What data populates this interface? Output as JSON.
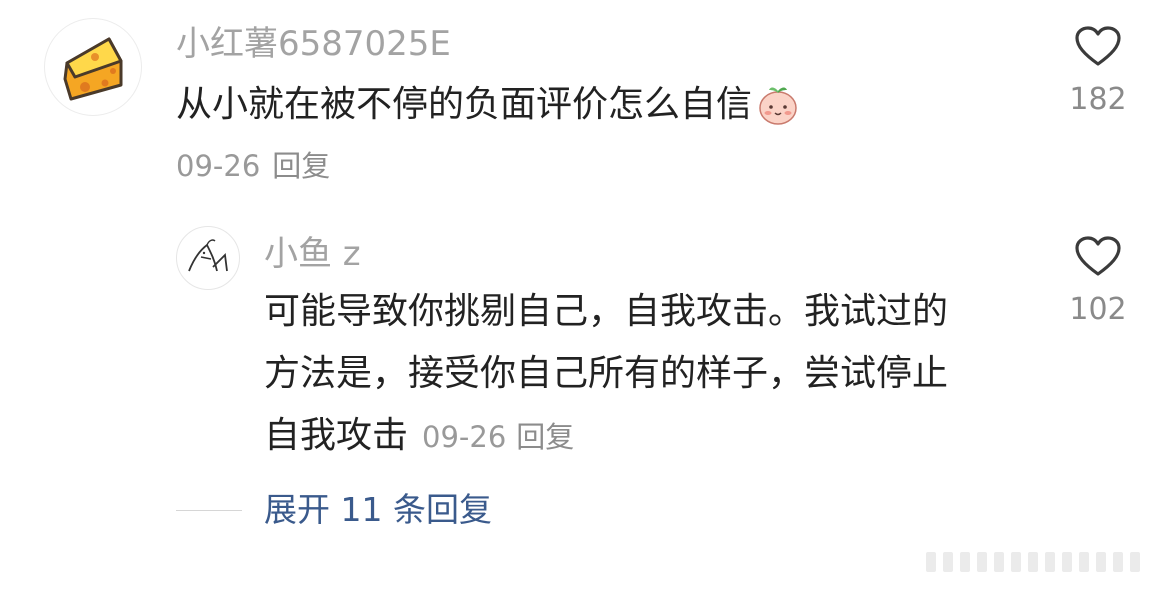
{
  "comment": {
    "username": "小红薯6587025E",
    "avatar_icon": "cheese-icon",
    "text": "从小就在被不停的负面评价怎么自信",
    "emoji_icon": "blushing-peach-emoji-icon",
    "date": "09-26",
    "reply_label": "回复",
    "likes": "182"
  },
  "reply": {
    "username": "小鱼 z",
    "avatar_icon": "sketch-doodle-icon",
    "lines": [
      "可能导致你挑剔自己，自我攻击。我试过的",
      "方法是，接受你自己所有的样子，尝试停止",
      "自我攻击"
    ],
    "date": "09-26",
    "reply_label": "回复",
    "likes": "102"
  },
  "expand": {
    "label": "展开 11 条回复"
  },
  "colors": {
    "username": "#a3a3a3",
    "text": "#222222",
    "meta": "#999999",
    "link": "#3a5a8c",
    "heart_outline": "#3b3b3b"
  }
}
